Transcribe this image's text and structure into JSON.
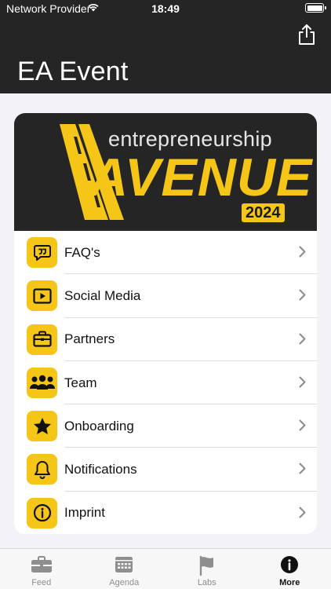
{
  "status_bar": {
    "carrier": "Network Provider",
    "time": "18:49"
  },
  "header": {
    "title": "EA Event"
  },
  "banner": {
    "word1": "entrepreneurship",
    "word2": "AVENUE",
    "year": "2024"
  },
  "menu": [
    {
      "label": "FAQ's",
      "icon": "quote-bubble-icon"
    },
    {
      "label": "Social Media",
      "icon": "play-icon"
    },
    {
      "label": "Partners",
      "icon": "briefcase-icon"
    },
    {
      "label": "Team",
      "icon": "people-icon"
    },
    {
      "label": "Onboarding",
      "icon": "star-icon"
    },
    {
      "label": "Notifications",
      "icon": "bell-icon"
    },
    {
      "label": "Imprint",
      "icon": "info-icon"
    }
  ],
  "tabs": [
    {
      "label": "Feed",
      "icon": "briefcase-icon",
      "active": false
    },
    {
      "label": "Agenda",
      "icon": "calendar-icon",
      "active": false
    },
    {
      "label": "Labs",
      "icon": "flag-icon",
      "active": false
    },
    {
      "label": "More",
      "icon": "info-icon",
      "active": true
    }
  ],
  "colors": {
    "accent": "#f5c518",
    "header_bg": "#252525",
    "page_bg": "#f2f2f7"
  }
}
